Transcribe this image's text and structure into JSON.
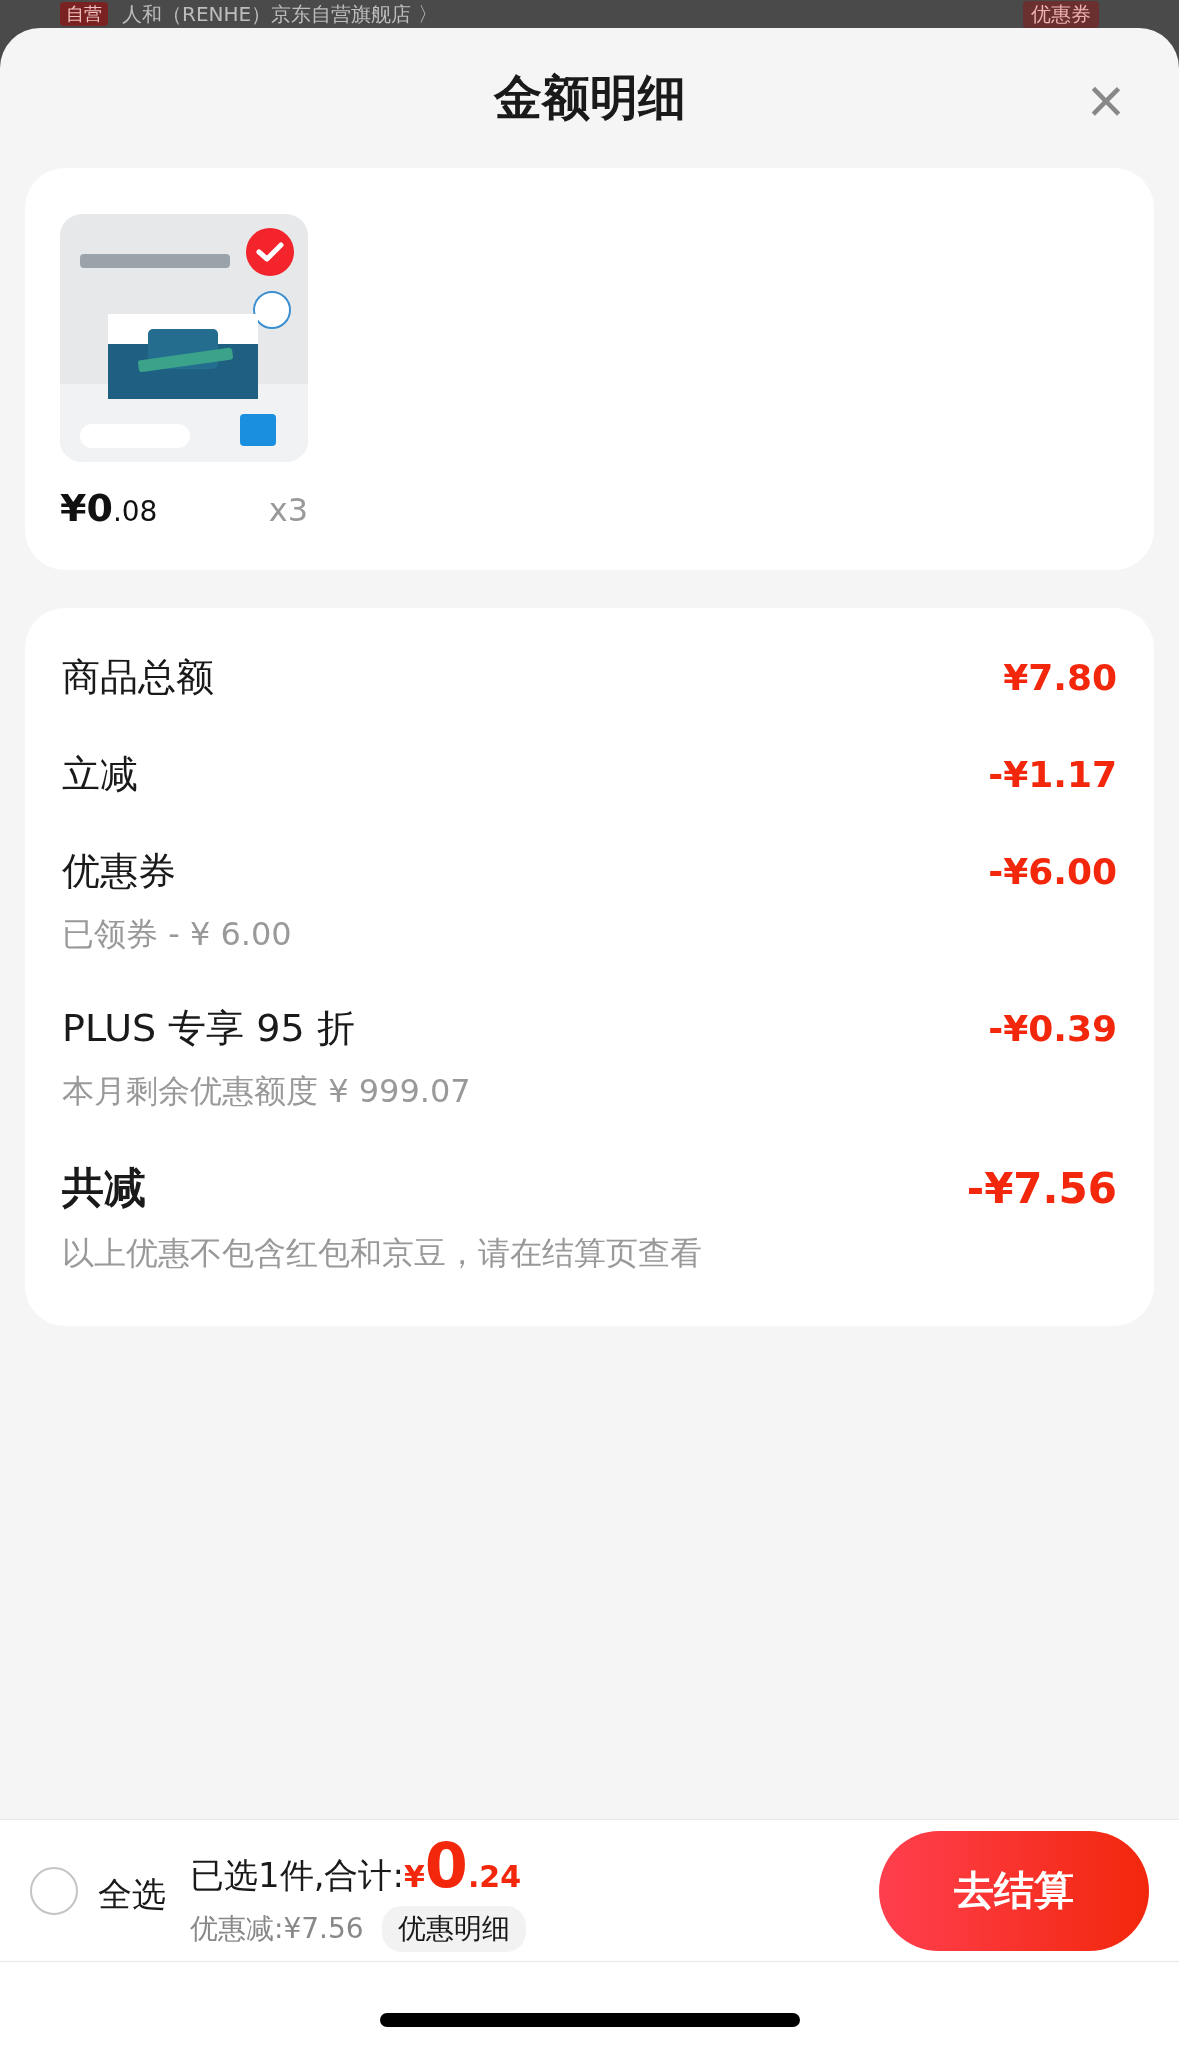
{
  "background_header": {
    "badge": "自营",
    "store": "人和（RENHE）京东自营旗舰店 〉",
    "coupon": "优惠券"
  },
  "sheet": {
    "title": "金额明细",
    "close": "×"
  },
  "products": [
    {
      "selected": true,
      "price_int": "¥0",
      "price_dec": ".08",
      "quantity": "x3"
    }
  ],
  "breakdown": [
    {
      "kind": "line",
      "label": "商品总额",
      "amount": "¥7.80"
    },
    {
      "kind": "line",
      "label": "立减",
      "amount": "-¥1.17"
    },
    {
      "kind": "line",
      "label": "优惠券",
      "amount": "-¥6.00",
      "note": "已领券 - ¥ 6.00"
    },
    {
      "kind": "line",
      "label": "PLUS 专享 95 折",
      "amount": "-¥0.39",
      "note": "本月剩余优惠额度 ¥ 999.07"
    },
    {
      "kind": "total",
      "label": "共减",
      "amount": "-¥7.56",
      "note": "以上优惠不包含红包和京豆，请在结算页查看"
    }
  ],
  "footer": {
    "select_all": {
      "label": "全选",
      "checked": false
    },
    "summary": "已选1件,合计:",
    "total_symbol": "¥",
    "total_int": "0",
    "total_dec": ".24",
    "discount": "优惠减:¥7.56",
    "detail_link": "优惠明细",
    "checkout": "去结算"
  }
}
